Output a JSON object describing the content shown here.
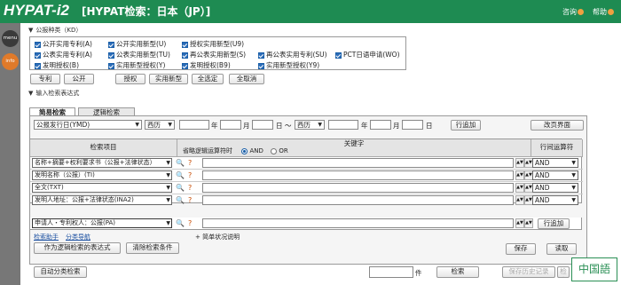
{
  "header": {
    "logo": "HYPAT-i2",
    "title": "[HYPAT检索：日本（JP）]",
    "links": [
      "咨询",
      "帮助"
    ]
  },
  "sidebar": [
    "menu",
    "info"
  ],
  "pub_section": {
    "title": "公报种类（KD）",
    "rows": [
      [
        "公开实用专利(A)",
        "公开实用新型(U)",
        "授权实用新型(U9)"
      ],
      [
        "公表实用专利(A)",
        "公表实用新型(TU)",
        "再公表实用新型(S)",
        "再公表实用专利(SU)",
        "PCT日语申请(WO)"
      ],
      [
        "发明授权(B)",
        "实用新型授权(Y)",
        "发明授权(B9)",
        "实用新型授权(Y9)"
      ]
    ],
    "buttons": [
      "专利",
      "公开",
      "授权",
      "实用新型",
      "全选定",
      "全取消"
    ]
  },
  "input_section": {
    "title": "输入检索表达式",
    "tabs": [
      "简易检索",
      "逻辑检索"
    ]
  },
  "date_row": {
    "field": "公报发行日(YMD)",
    "era1": "西历",
    "era2": "西历",
    "year": "年",
    "month": "月",
    "day": "日",
    "tilde": "～",
    "add_button": "行追加",
    "change_button": "改页界面"
  },
  "table": {
    "col_item": "检索项目",
    "col_keyword": "关键字",
    "sub_label": "省略逻辑运算符时",
    "and": "AND",
    "or": "OR",
    "col_op": "行间运算符",
    "rows": [
      {
        "item": "名称+摘要+权利要求书（公报+法律状态）",
        "op": "AND"
      },
      {
        "item": "发明名称（公报）(TI)",
        "op": "AND"
      },
      {
        "item": "全文(TXT)",
        "op": "AND"
      },
      {
        "item": "发明人地址：公报+法律状态(INA2)",
        "op": "AND"
      },
      {
        "item": "申请人・专利权人：公报(PA)",
        "op": ""
      }
    ],
    "row_add": "行追加"
  },
  "bottom": {
    "links": [
      "检索助手",
      "分类导航"
    ],
    "simple_status": "简单状况说明",
    "btn_logic": "作为逻辑检索的表达式",
    "btn_clear": "清除检索条件",
    "btn_save": "保存",
    "btn_read": "读取",
    "btn_auto": "自动分类检索",
    "count_unit": "件",
    "btn_search": "检索",
    "btn_history": "保存历史记录",
    "btn_more": "检索"
  },
  "language_badge": "中国語",
  "colors": {
    "header": "#1e8b52",
    "check": "#2b6cb8"
  }
}
